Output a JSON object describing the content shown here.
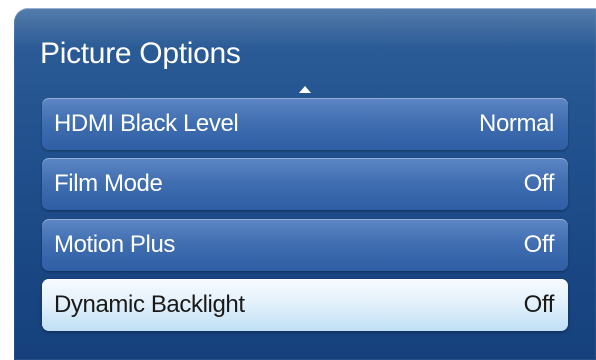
{
  "menu": {
    "title": "Picture Options",
    "items": [
      {
        "label": "HDMI Black Level",
        "value": "Normal",
        "selected": false
      },
      {
        "label": "Film Mode",
        "value": "Off",
        "selected": false
      },
      {
        "label": "Motion Plus",
        "value": "Off",
        "selected": false
      },
      {
        "label": "Dynamic Backlight",
        "value": "Off",
        "selected": true
      }
    ],
    "scroll_indicator": "up-arrow-icon"
  },
  "colors": {
    "panel_top": "#2f5f99",
    "panel_bottom": "#15407c",
    "item_blue": "#3f6db0",
    "selected_item": "#e4f1fb",
    "text_light": "#ffffff",
    "text_dark": "#1a1a1a"
  }
}
